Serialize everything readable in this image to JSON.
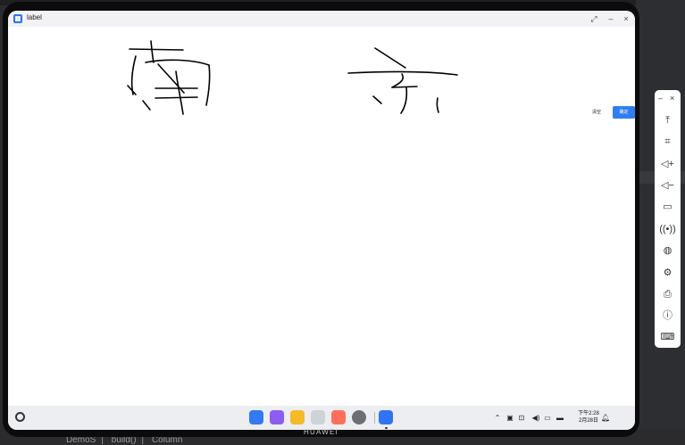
{
  "window": {
    "title": "label",
    "controls": [
      "⤢",
      "–",
      "×"
    ]
  },
  "buttons": {
    "clear_label": "清空",
    "confirm_label": "确定"
  },
  "taskbar": {
    "time": "下午2:28",
    "date": "2月28日",
    "dock_apps": [
      "app-launcher",
      "gallery",
      "notes",
      "trash",
      "photos",
      "settings",
      "label-app"
    ]
  },
  "device": {
    "brand": "HUAWEI"
  },
  "ide": {
    "breadcrumbs": [
      "DemoS",
      "build()",
      "Column"
    ]
  },
  "side_toolbar": {
    "items": [
      "to-top",
      "crop",
      "volume-up",
      "volume-down",
      "rotate",
      "wireless",
      "globe",
      "settings",
      "printer",
      "info",
      "keyboard"
    ]
  }
}
